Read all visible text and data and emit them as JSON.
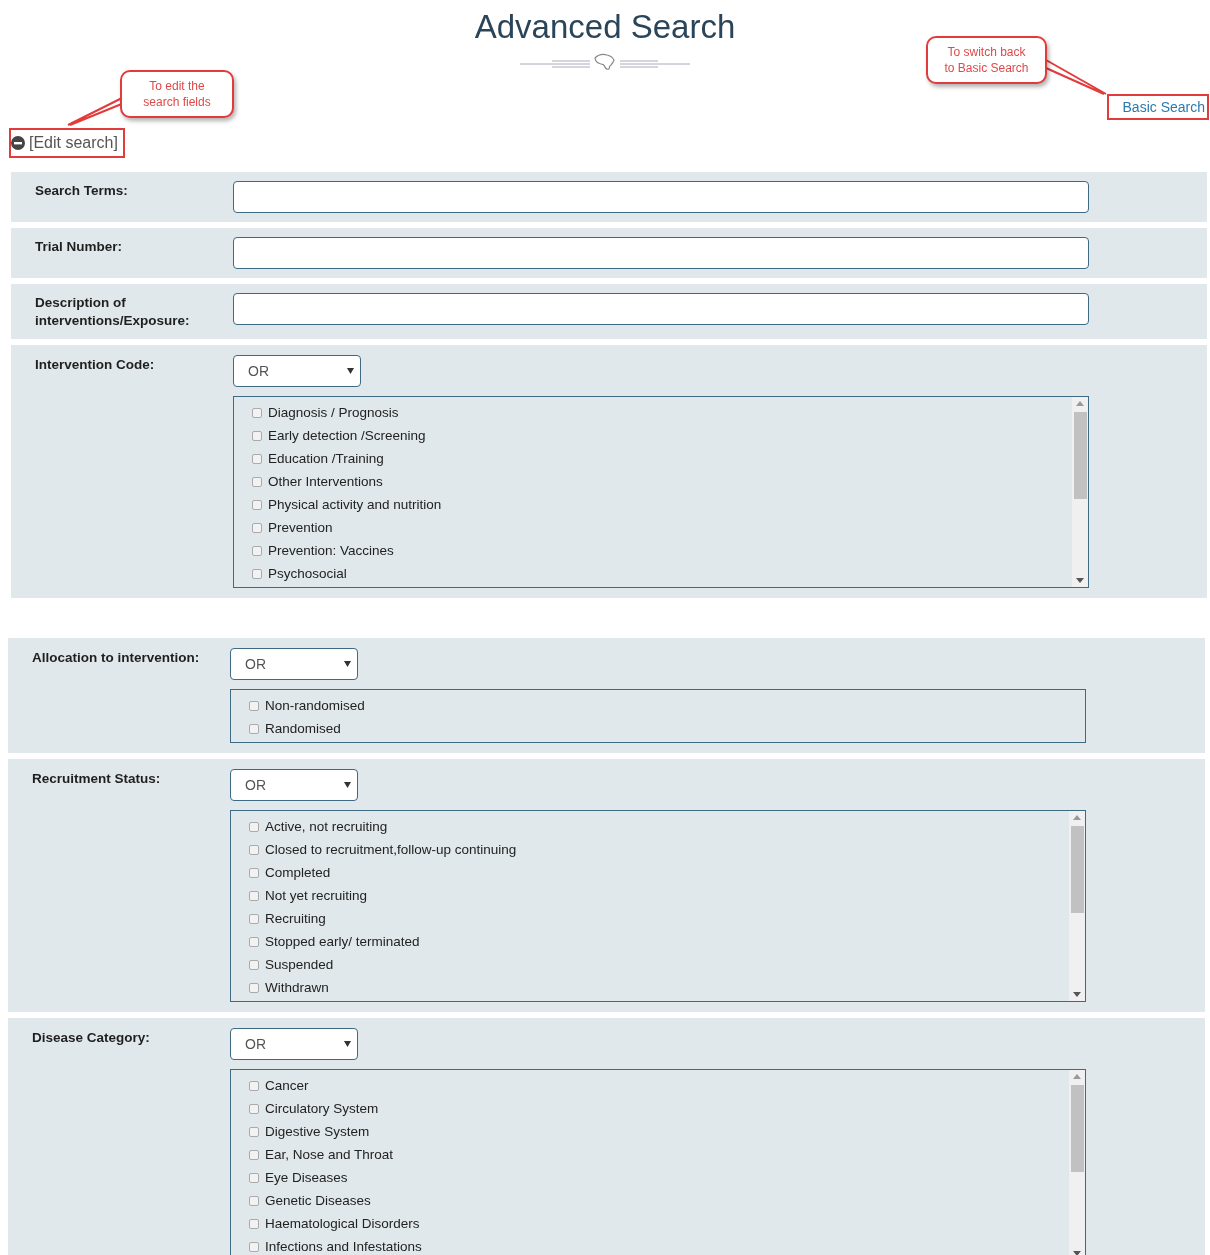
{
  "title": "Advanced Search",
  "annotations": [
    {
      "lines": [
        "To edit the",
        "search fields"
      ]
    },
    {
      "lines": [
        "To switch back",
        "to Basic Search"
      ]
    }
  ],
  "edit_search": {
    "label": "[Edit search]",
    "highlighted": true
  },
  "basic_search": {
    "label": "Basic Search",
    "highlighted": true
  },
  "groups": [
    {
      "sections": [
        {
          "kind": "text",
          "label": "Search Terms:"
        },
        {
          "kind": "text",
          "label": "Trial Number:"
        },
        {
          "kind": "text",
          "label": "Description of interventions/Exposure:"
        },
        {
          "kind": "checklist",
          "label": "Intervention Code:",
          "operator": "OR",
          "scrollable": true,
          "options": [
            {
              "label": "Diagnosis / Prognosis",
              "checked": false
            },
            {
              "label": "Early detection /Screening",
              "checked": false
            },
            {
              "label": "Education /Training",
              "checked": false
            },
            {
              "label": "Other Interventions",
              "checked": false
            },
            {
              "label": "Physical activity and nutrition",
              "checked": false
            },
            {
              "label": "Prevention",
              "checked": false
            },
            {
              "label": "Prevention: Vaccines",
              "checked": false
            },
            {
              "label": "Psychosocial",
              "checked": false
            }
          ]
        }
      ]
    },
    {
      "sections": [
        {
          "kind": "checklist",
          "label": "Allocation to intervention:",
          "operator": "OR",
          "scrollable": false,
          "options": [
            {
              "label": "Non-randomised",
              "checked": false
            },
            {
              "label": "Randomised",
              "checked": false
            }
          ]
        },
        {
          "kind": "checklist",
          "label": "Recruitment Status:",
          "operator": "OR",
          "scrollable": true,
          "options": [
            {
              "label": "Active, not recruiting",
              "checked": false
            },
            {
              "label": "Closed to recruitment,follow-up continuing",
              "checked": false
            },
            {
              "label": "Completed",
              "checked": false
            },
            {
              "label": "Not yet recruiting",
              "checked": false
            },
            {
              "label": "Recruiting",
              "checked": false
            },
            {
              "label": "Stopped early/ terminated",
              "checked": false
            },
            {
              "label": "Suspended",
              "checked": false
            },
            {
              "label": "Withdrawn",
              "checked": false
            }
          ]
        },
        {
          "kind": "checklist",
          "label": "Disease Category:",
          "operator": "OR",
          "scrollable": true,
          "options": [
            {
              "label": "Cancer",
              "checked": false
            },
            {
              "label": "Circulatory System",
              "checked": false
            },
            {
              "label": "Digestive System",
              "checked": false
            },
            {
              "label": "Ear, Nose and Throat",
              "checked": false
            },
            {
              "label": "Eye Diseases",
              "checked": false
            },
            {
              "label": "Genetic Diseases",
              "checked": false
            },
            {
              "label": "Haematological Disorders",
              "checked": false
            },
            {
              "label": "Infections and Infestations",
              "checked": false
            }
          ]
        }
      ]
    }
  ]
}
